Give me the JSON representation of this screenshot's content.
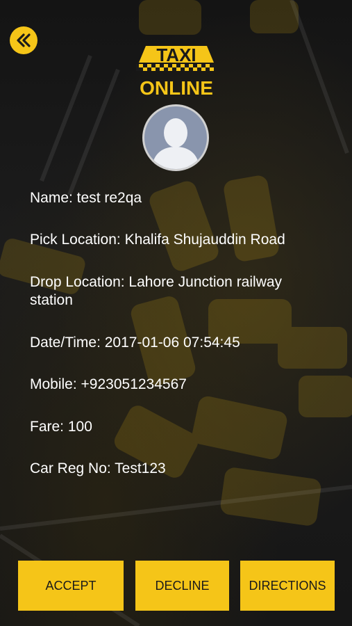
{
  "header": {
    "back_icon": "double-chevron-left-icon",
    "logo_line1": "TAXI",
    "logo_line2": "ONLINE"
  },
  "profile": {
    "avatar_icon": "user-silhouette-icon"
  },
  "details": {
    "name": "Name: test re2qa",
    "pick_location": "Pick Location: Khalifa Shujauddin Road",
    "drop_location": "Drop Location: Lahore Junction railway station",
    "datetime": "Date/Time: 2017-01-06 07:54:45",
    "mobile": "Mobile: +923051234567",
    "fare": "Fare: 100",
    "car_reg": "Car Reg No: Test123"
  },
  "actions": {
    "accept": "ACCEPT",
    "decline": "DECLINE",
    "directions": "DIRECTIONS"
  },
  "colors": {
    "accent": "#f5c518",
    "text": "#ffffff",
    "button_text": "#1a1a1a",
    "background": "#141414"
  }
}
